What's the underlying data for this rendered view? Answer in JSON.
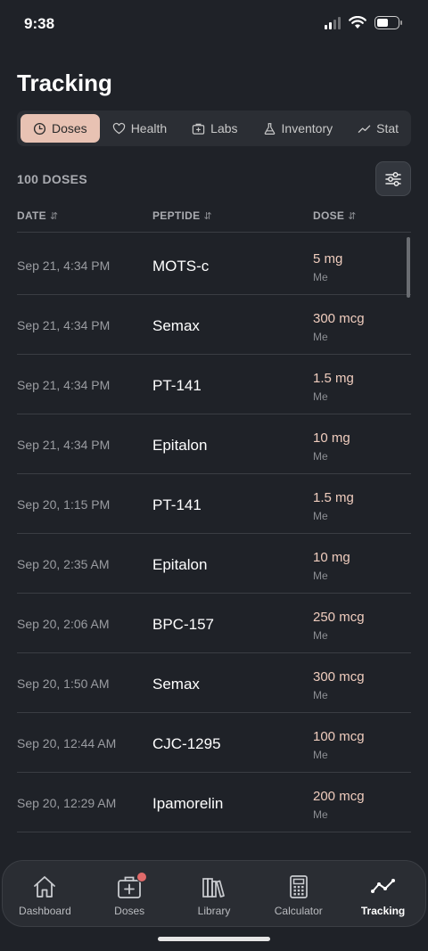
{
  "status": {
    "time": "9:38"
  },
  "page": {
    "title": "Tracking"
  },
  "tabs": [
    {
      "label": "Doses",
      "icon": "clock-icon",
      "active": true
    },
    {
      "label": "Health",
      "icon": "heart-icon"
    },
    {
      "label": "Labs",
      "icon": "medical-kit-icon"
    },
    {
      "label": "Inventory",
      "icon": "flask-icon"
    },
    {
      "label": "Stat",
      "icon": "trend-icon"
    }
  ],
  "list": {
    "count_label": "100 DOSES",
    "columns": {
      "date": "DATE",
      "peptide": "PEPTIDE",
      "dose": "DOSE"
    },
    "sort_glyph": "⇵",
    "rows": [
      {
        "date": "Sep 21, 4:34 PM",
        "peptide": "MOTS-c",
        "dose": "5 mg",
        "who": "Me"
      },
      {
        "date": "Sep 21, 4:34 PM",
        "peptide": "Semax",
        "dose": "300 mcg",
        "who": "Me"
      },
      {
        "date": "Sep 21, 4:34 PM",
        "peptide": "PT-141",
        "dose": "1.5 mg",
        "who": "Me"
      },
      {
        "date": "Sep 21, 4:34 PM",
        "peptide": "Epitalon",
        "dose": "10 mg",
        "who": "Me"
      },
      {
        "date": "Sep 20, 1:15 PM",
        "peptide": "PT-141",
        "dose": "1.5 mg",
        "who": "Me"
      },
      {
        "date": "Sep 20, 2:35 AM",
        "peptide": "Epitalon",
        "dose": "10 mg",
        "who": "Me"
      },
      {
        "date": "Sep 20, 2:06 AM",
        "peptide": "BPC-157",
        "dose": "250 mcg",
        "who": "Me"
      },
      {
        "date": "Sep 20, 1:50 AM",
        "peptide": "Semax",
        "dose": "300 mcg",
        "who": "Me"
      },
      {
        "date": "Sep 20, 12:44 AM",
        "peptide": "CJC-1295",
        "dose": "100 mcg",
        "who": "Me"
      },
      {
        "date": "Sep 20, 12:29 AM",
        "peptide": "Ipamorelin",
        "dose": "200 mcg",
        "who": "Me"
      }
    ]
  },
  "nav": {
    "items": [
      {
        "label": "Dashboard",
        "icon": "home-icon"
      },
      {
        "label": "Doses",
        "icon": "medical-kit-icon"
      },
      {
        "label": "Library",
        "icon": "books-icon"
      },
      {
        "label": "Calculator",
        "icon": "calculator-icon"
      },
      {
        "label": "Tracking",
        "icon": "trend-icon",
        "active": true
      }
    ]
  },
  "colors": {
    "accent": "#e8c2b3",
    "background": "#1f2228",
    "dose_text": "#f0cdbe",
    "badge": "#e06a6a"
  }
}
